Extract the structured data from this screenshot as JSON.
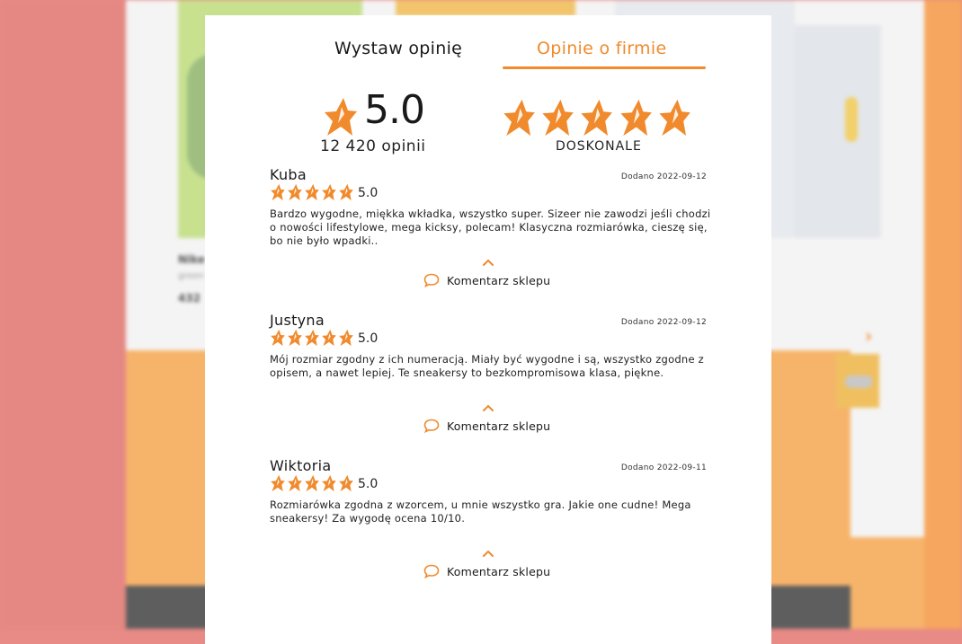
{
  "colors": {
    "accent": "#f08a2c",
    "star_fill": "#f08a2c"
  },
  "background": {
    "product_name": "Nike",
    "product_subtitle": "green",
    "product_price": "432"
  },
  "tabs": [
    {
      "label": "Wystaw opinię",
      "active": false
    },
    {
      "label": "Opinie o firmie",
      "active": true
    }
  ],
  "summary": {
    "score": "5.0",
    "count": "12 420 opinii",
    "stars": 5,
    "verdict": "DOSKONALE"
  },
  "reviews": [
    {
      "name": "Kuba",
      "date": "Dodano 2022-09-12",
      "rating": "5.0",
      "stars": 5,
      "text": "Bardzo wygodne, miękka wkładka, wszystko super. Sizeer nie zawodzi jeśli chodzi o nowości lifestylowe, mega kicksy, polecam! Klasyczna rozmiarówka, cieszę się, bo nie było wpadki..",
      "comment_label": "Komentarz sklepu"
    },
    {
      "name": "Justyna",
      "date": "Dodano 2022-09-12",
      "rating": "5.0",
      "stars": 5,
      "text": "Mój rozmiar zgodny z ich numeracją. Miały być wygodne i są, wszystko zgodne z opisem, a nawet lepiej. Te sneakersy to bezkompromisowa klasa, piękne.",
      "comment_label": "Komentarz sklepu"
    },
    {
      "name": "Wiktoria",
      "date": "Dodano 2022-09-11",
      "rating": "5.0",
      "stars": 5,
      "text": "Rozmiarówka zgodna z wzorcem, u mnie wszystko gra. Jakie one cudne! Mega sneakersy! Za wygodę ocena 10/10.",
      "comment_label": "Komentarz sklepu"
    }
  ]
}
